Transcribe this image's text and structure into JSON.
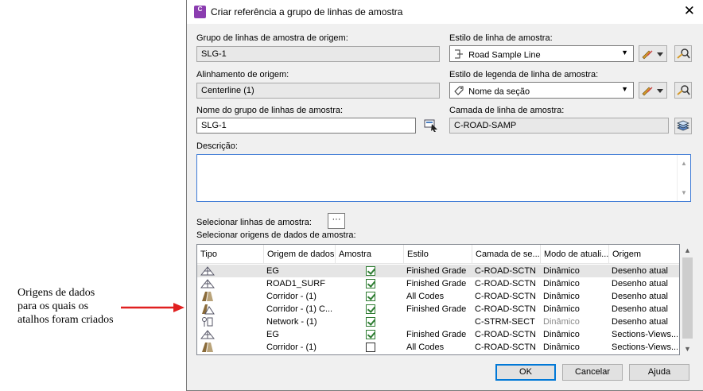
{
  "annotation": {
    "lines": [
      "Origens de dados",
      "para os quais os",
      "atalhos foram criados"
    ]
  },
  "dialog": {
    "title": "Criar referência a grupo de linhas de amostra",
    "app_icon_label": "C",
    "fields": {
      "source_group_label": "Grupo de linhas de amostra de origem:",
      "source_group_value": "SLG-1",
      "source_alignment_label": "Alinhamento de origem:",
      "source_alignment_value": "Centerline (1)",
      "group_name_label": "Nome do grupo de linhas de amostra:",
      "group_name_value": "SLG-1",
      "sample_line_style_label": "Estilo de linha de amostra:",
      "sample_line_style_value": "Road Sample Line",
      "label_style_label": "Estilo de legenda de linha de amostra:",
      "label_style_value": "Nome da seção",
      "layer_label": "Camada de linha de amostra:",
      "layer_value": "C-ROAD-SAMP",
      "description_label": "Descrição:",
      "description_value": "",
      "select_lines_label": "Selecionar linhas de amostra:",
      "select_sources_label": "Selecionar origens de dados de amostra:"
    },
    "table": {
      "columns": [
        "Tipo",
        "Origem de dados",
        "Amostra",
        "Estilo",
        "Camada de se...",
        "Modo de atuali...",
        "Origem"
      ],
      "rows": [
        {
          "source": "EG",
          "sample": true,
          "style": "Finished Grade",
          "layer": "C-ROAD-SCTN",
          "mode": "Dinâmico",
          "origin": "Desenho atual",
          "icon": "surface-icon",
          "mode_disabled": false
        },
        {
          "source": "ROAD1_SURF",
          "sample": true,
          "style": "Finished Grade",
          "layer": "C-ROAD-SCTN",
          "mode": "Dinâmico",
          "origin": "Desenho atual",
          "icon": "surface-icon",
          "mode_disabled": false
        },
        {
          "source": "Corridor - (1)",
          "sample": true,
          "style": "All Codes",
          "layer": "C-ROAD-SCTN",
          "mode": "Dinâmico",
          "origin": "Desenho atual",
          "icon": "corridor-icon",
          "mode_disabled": false
        },
        {
          "source": "Corridor - (1) C...",
          "sample": true,
          "style": "Finished Grade",
          "layer": "C-ROAD-SCTN",
          "mode": "Dinâmico",
          "origin": "Desenho atual",
          "icon": "corridor-surface-icon",
          "mode_disabled": false
        },
        {
          "source": "Network - (1)",
          "sample": true,
          "style": "",
          "layer": "C-STRM-SECT",
          "mode": "Dinâmico",
          "origin": "Desenho atual",
          "icon": "pipe-network-icon",
          "mode_disabled": true
        },
        {
          "source": "EG",
          "sample": true,
          "style": "Finished Grade",
          "layer": "C-ROAD-SCTN",
          "mode": "Dinâmico",
          "origin": "Sections-Views...",
          "icon": "surface-icon",
          "mode_disabled": false
        },
        {
          "source": "Corridor - (1)",
          "sample": false,
          "style": "All Codes",
          "layer": "C-ROAD-SCTN",
          "mode": "Dinâmico",
          "origin": "Sections-Views...",
          "icon": "corridor-icon",
          "mode_disabled": false
        }
      ]
    },
    "buttons": {
      "ok": "OK",
      "cancel": "Cancelar",
      "help": "Ajuda",
      "dots": "···"
    },
    "colors": {
      "accent": "#0078d7",
      "annotation_arrow": "#e02020",
      "app_icon": "#8b3db0"
    }
  }
}
